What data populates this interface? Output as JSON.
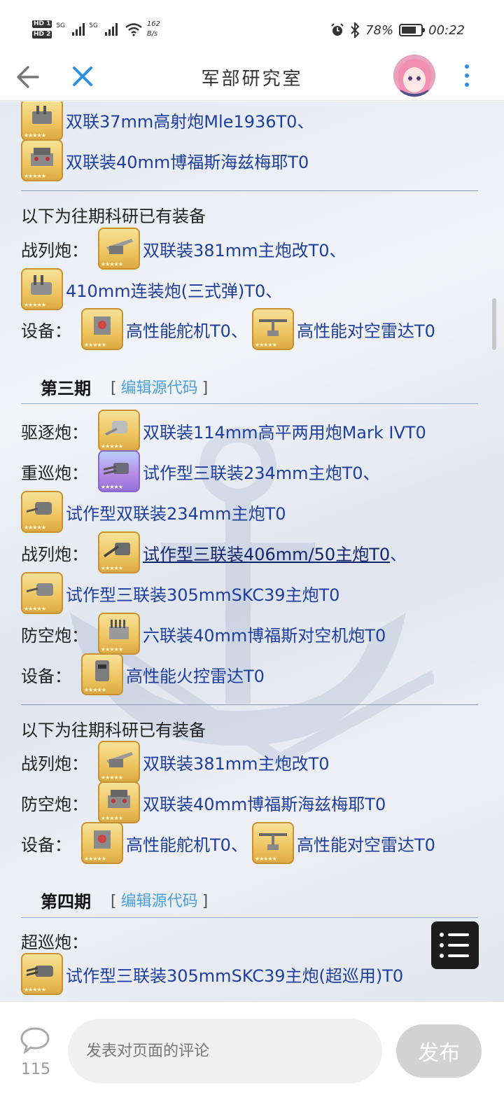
{
  "status_bar": {
    "hd1": "HD 1",
    "hd2": "HD 2",
    "sig1": "5G",
    "sig2": "5G",
    "net_speed_value": "162",
    "net_speed_unit": "B/s",
    "battery": "78%",
    "battery_level": 0.78,
    "time": "00:22"
  },
  "app_bar": {
    "title": "军部研究室"
  },
  "sections": {
    "top_item1": "双联37mm高射炮Mle1936T0",
    "top_item1_sep": "、",
    "top_item2": "双联装40mm博福斯海兹梅耶T0",
    "prev1_heading": "以下为往期科研已有装备",
    "prev1_bb_label": "战列炮：",
    "prev1_bb_item1": "双联装381mm主炮改T0",
    "prev1_bb_sep": "、",
    "prev1_bb_item2": "410mm连装炮(三式弹)T0",
    "prev1_bb_sep2": "、",
    "prev1_eq_label": "设备：",
    "prev1_eq_item1": "高性能舵机T0",
    "prev1_eq_sep": "、",
    "prev1_eq_item2": "高性能对空雷达T0",
    "s3_title": "第三期",
    "s3_edit_open": "[",
    "s3_edit": "编辑源代码",
    "s3_edit_close": "]",
    "s3_dd_label": "驱逐炮：",
    "s3_dd_item": "双联装114mm高平两用炮Mark IVT0",
    "s3_ca_label": "重巡炮：",
    "s3_ca_item1": "试作型三联装234mm主炮T0",
    "s3_ca_sep": "、",
    "s3_ca_item2": "试作型双联装234mm主炮T0",
    "s3_bb_label": "战列炮：",
    "s3_bb_item1": "试作型三联装406mm/50主炮T0",
    "s3_bb_sep": "、",
    "s3_bb_item2": "试作型三联装305mmSKC39主炮T0",
    "s3_aa_label": "防空炮：",
    "s3_aa_item": "六联装40mm博福斯对空机炮T0",
    "s3_eq_label": "设备：",
    "s3_eq_item": "高性能火控雷达T0",
    "prev2_heading": "以下为往期科研已有装备",
    "prev2_bb_label": "战列炮：",
    "prev2_bb_item": "双联装381mm主炮改T0",
    "prev2_aa_label": "防空炮：",
    "prev2_aa_item": "双联装40mm博福斯海兹梅耶T0",
    "prev2_eq_label": "设备：",
    "prev2_eq_item1": "高性能舵机T0",
    "prev2_eq_sep": "、",
    "prev2_eq_item2": "高性能对空雷达T0",
    "s4_title": "第四期",
    "s4_edit_open": "[",
    "s4_edit": "编辑源代码",
    "s4_edit_close": "]",
    "s4_cb_label": "超巡炮：",
    "s4_cb_item": "试作型三联装305mmSKC39主炮(超巡用)T0"
  },
  "bottom_bar": {
    "comment_count": "115",
    "comment_placeholder": "发表对页面的评论",
    "publish": "发布"
  },
  "colors": {
    "link": "#1f3f9e",
    "edit_link": "#4aa0dc",
    "accent": "#2f8ee0"
  },
  "icons": [
    "back-arrow-icon",
    "close-icon",
    "more-vert-icon",
    "toc-list-icon",
    "comment-bubble-icon",
    "equipment-icon"
  ]
}
